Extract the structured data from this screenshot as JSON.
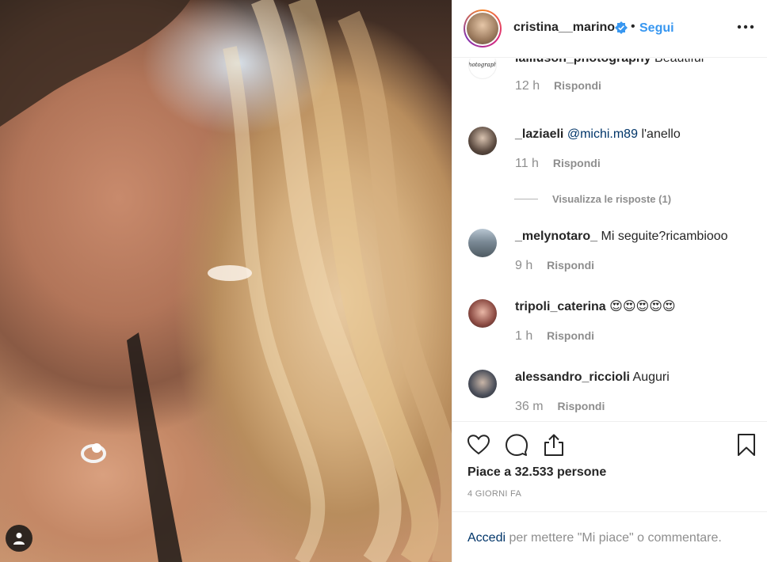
{
  "post": {
    "author": "cristina__marino",
    "follow_label": "Segui",
    "dot": "•",
    "likes_label": "Piace a 32.533 persone",
    "date_label": "4 GIORNI FA"
  },
  "comments": [
    {
      "username": "lailluson_photography",
      "text": "Beautiful",
      "time": "12 h",
      "reply": "Rispondi",
      "avatar_text": "Photography"
    },
    {
      "username": "_laziaeli",
      "mention": "@michi.m89",
      "text": "l'anello",
      "time": "11 h",
      "reply": "Rispondi"
    },
    {
      "username": "_melynotaro_",
      "text": "Mi seguite?ricambiooo",
      "time": "9 h",
      "reply": "Rispondi"
    },
    {
      "username": "tripoli_caterina",
      "text": "😍😍😍😍😍",
      "time": "1 h",
      "reply": "Rispondi"
    },
    {
      "username": "alessandro_riccioli",
      "text": "Auguri",
      "time": "36 m",
      "reply": "Rispondi"
    }
  ],
  "view_replies": "Visualizza le risposte (1)",
  "footer": {
    "login_label": "Accedi",
    "rest_label": " per mettere \"Mi piace\" o commentare."
  },
  "icons": {
    "verified": "verified-badge-icon",
    "more": "more-options-icon",
    "like": "heart-icon",
    "comment": "comment-icon",
    "share": "share-icon",
    "save": "bookmark-icon",
    "user": "user-tag-icon"
  },
  "colors": {
    "link_blue": "#3897f0",
    "mention_blue": "#003569",
    "muted": "#8e8e8e",
    "text": "#262626"
  }
}
